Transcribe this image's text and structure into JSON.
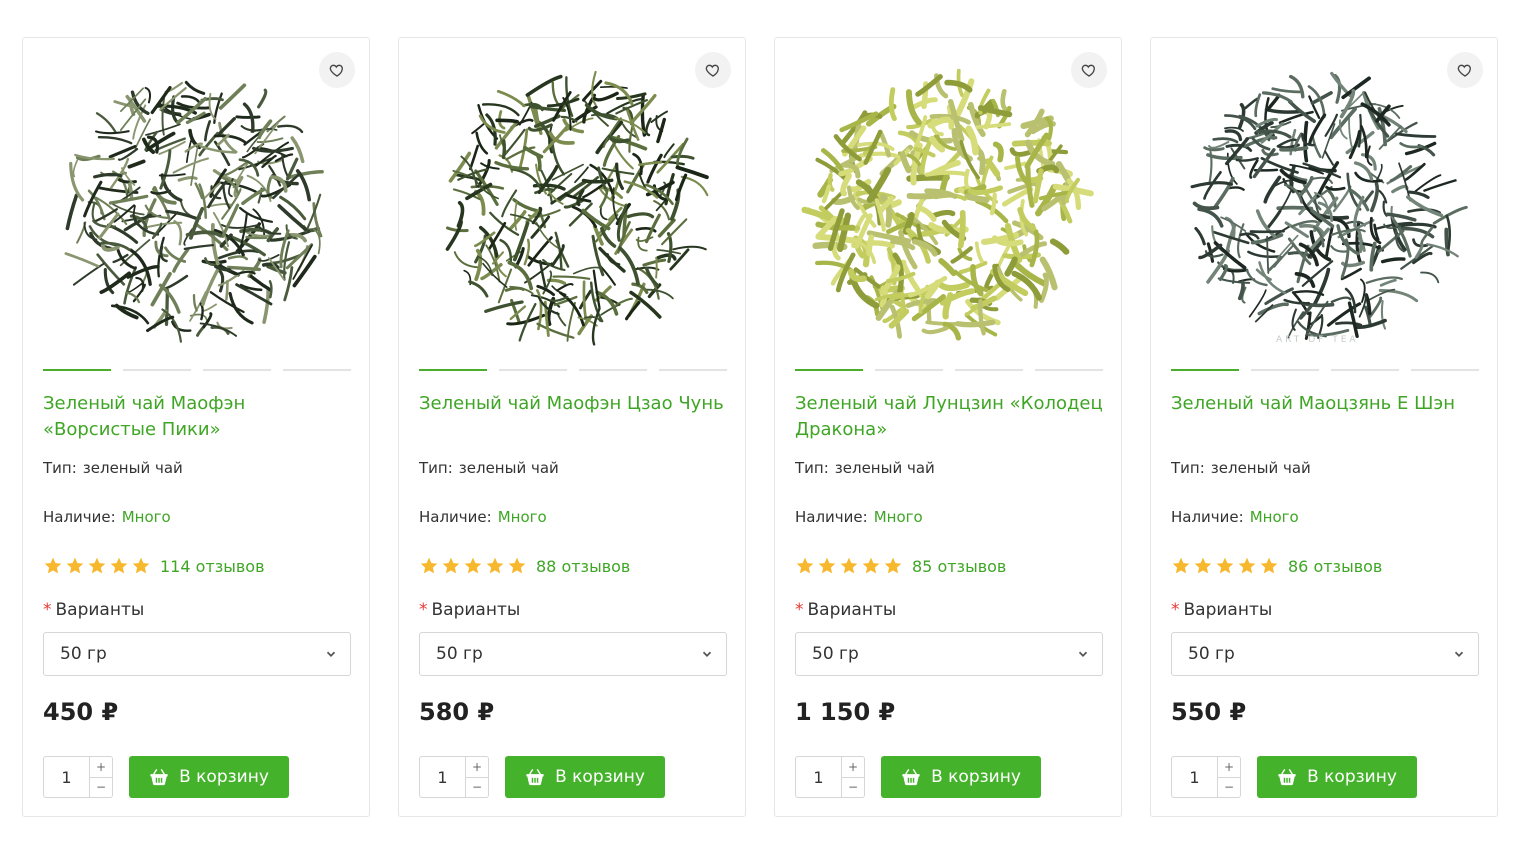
{
  "colors": {
    "accent": "#45b22b",
    "link": "#3fa625",
    "star": "#f7b82e",
    "required": "#e53935"
  },
  "products": [
    {
      "title": "Зеленый чай Маофэн «Ворсистые Пики»",
      "type_label": "Тип:",
      "type_value": "зеленый чай",
      "stock_label": "Наличие:",
      "stock_value": "Много",
      "reviews": "114 отзывов",
      "variants_label": "Варианты",
      "variant_selected": "50 гр",
      "price": "450 ₽",
      "qty": "1",
      "cart_label": "В корзину",
      "watermark": ""
    },
    {
      "title": "Зеленый чай Маофэн Цзао Чунь",
      "type_label": "Тип:",
      "type_value": "зеленый чай",
      "stock_label": "Наличие:",
      "stock_value": "Много",
      "reviews": "88 отзывов",
      "variants_label": "Варианты",
      "variant_selected": "50 гр",
      "price": "580 ₽",
      "qty": "1",
      "cart_label": "В корзину",
      "watermark": ""
    },
    {
      "title": "Зеленый чай Лунцзин «Колодец Дракона»",
      "type_label": "Тип:",
      "type_value": "зеленый чай",
      "stock_label": "Наличие:",
      "stock_value": "Много",
      "reviews": "85 отзывов",
      "variants_label": "Варианты",
      "variant_selected": "50 гр",
      "price": "1 150 ₽",
      "qty": "1",
      "cart_label": "В корзину",
      "watermark": ""
    },
    {
      "title": "Зеленый чай Маоцзянь Е Шэн",
      "type_label": "Тип:",
      "type_value": "зеленый чай",
      "stock_label": "Наличие:",
      "stock_value": "Много",
      "reviews": "86 отзывов",
      "variants_label": "Варианты",
      "variant_selected": "50 гр",
      "price": "550 ₽",
      "qty": "1",
      "cart_label": "В корзину",
      "watermark": "ART OF TEA"
    }
  ],
  "stepper": {
    "plus": "+",
    "minus": "−"
  },
  "rating_stars": 5
}
